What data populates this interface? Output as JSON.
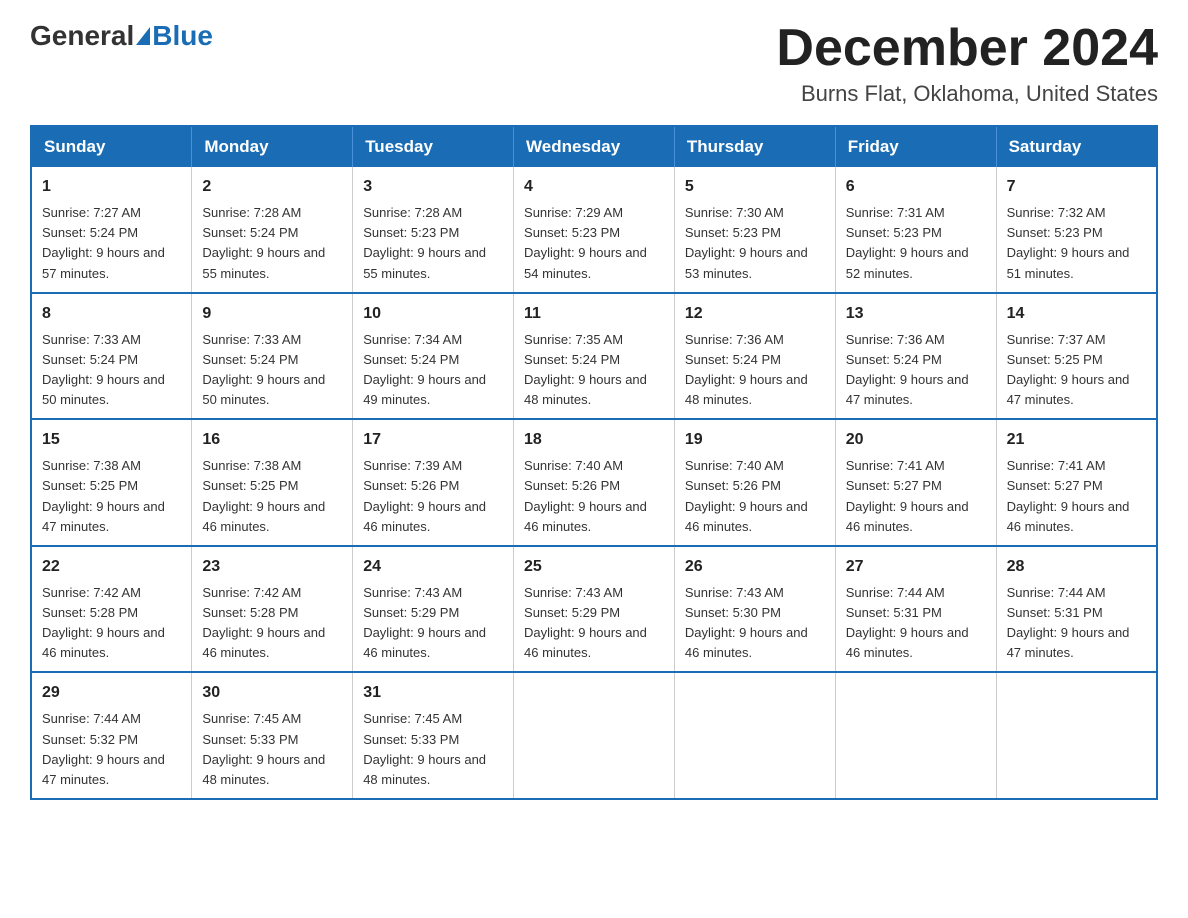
{
  "header": {
    "logo_general": "General",
    "logo_blue": "Blue",
    "month_title": "December 2024",
    "location": "Burns Flat, Oklahoma, United States"
  },
  "days_of_week": [
    "Sunday",
    "Monday",
    "Tuesday",
    "Wednesday",
    "Thursday",
    "Friday",
    "Saturday"
  ],
  "weeks": [
    [
      {
        "day": "1",
        "sunrise": "7:27 AM",
        "sunset": "5:24 PM",
        "daylight": "9 hours and 57 minutes."
      },
      {
        "day": "2",
        "sunrise": "7:28 AM",
        "sunset": "5:24 PM",
        "daylight": "9 hours and 55 minutes."
      },
      {
        "day": "3",
        "sunrise": "7:28 AM",
        "sunset": "5:23 PM",
        "daylight": "9 hours and 55 minutes."
      },
      {
        "day": "4",
        "sunrise": "7:29 AM",
        "sunset": "5:23 PM",
        "daylight": "9 hours and 54 minutes."
      },
      {
        "day": "5",
        "sunrise": "7:30 AM",
        "sunset": "5:23 PM",
        "daylight": "9 hours and 53 minutes."
      },
      {
        "day": "6",
        "sunrise": "7:31 AM",
        "sunset": "5:23 PM",
        "daylight": "9 hours and 52 minutes."
      },
      {
        "day": "7",
        "sunrise": "7:32 AM",
        "sunset": "5:23 PM",
        "daylight": "9 hours and 51 minutes."
      }
    ],
    [
      {
        "day": "8",
        "sunrise": "7:33 AM",
        "sunset": "5:24 PM",
        "daylight": "9 hours and 50 minutes."
      },
      {
        "day": "9",
        "sunrise": "7:33 AM",
        "sunset": "5:24 PM",
        "daylight": "9 hours and 50 minutes."
      },
      {
        "day": "10",
        "sunrise": "7:34 AM",
        "sunset": "5:24 PM",
        "daylight": "9 hours and 49 minutes."
      },
      {
        "day": "11",
        "sunrise": "7:35 AM",
        "sunset": "5:24 PM",
        "daylight": "9 hours and 48 minutes."
      },
      {
        "day": "12",
        "sunrise": "7:36 AM",
        "sunset": "5:24 PM",
        "daylight": "9 hours and 48 minutes."
      },
      {
        "day": "13",
        "sunrise": "7:36 AM",
        "sunset": "5:24 PM",
        "daylight": "9 hours and 47 minutes."
      },
      {
        "day": "14",
        "sunrise": "7:37 AM",
        "sunset": "5:25 PM",
        "daylight": "9 hours and 47 minutes."
      }
    ],
    [
      {
        "day": "15",
        "sunrise": "7:38 AM",
        "sunset": "5:25 PM",
        "daylight": "9 hours and 47 minutes."
      },
      {
        "day": "16",
        "sunrise": "7:38 AM",
        "sunset": "5:25 PM",
        "daylight": "9 hours and 46 minutes."
      },
      {
        "day": "17",
        "sunrise": "7:39 AM",
        "sunset": "5:26 PM",
        "daylight": "9 hours and 46 minutes."
      },
      {
        "day": "18",
        "sunrise": "7:40 AM",
        "sunset": "5:26 PM",
        "daylight": "9 hours and 46 minutes."
      },
      {
        "day": "19",
        "sunrise": "7:40 AM",
        "sunset": "5:26 PM",
        "daylight": "9 hours and 46 minutes."
      },
      {
        "day": "20",
        "sunrise": "7:41 AM",
        "sunset": "5:27 PM",
        "daylight": "9 hours and 46 minutes."
      },
      {
        "day": "21",
        "sunrise": "7:41 AM",
        "sunset": "5:27 PM",
        "daylight": "9 hours and 46 minutes."
      }
    ],
    [
      {
        "day": "22",
        "sunrise": "7:42 AM",
        "sunset": "5:28 PM",
        "daylight": "9 hours and 46 minutes."
      },
      {
        "day": "23",
        "sunrise": "7:42 AM",
        "sunset": "5:28 PM",
        "daylight": "9 hours and 46 minutes."
      },
      {
        "day": "24",
        "sunrise": "7:43 AM",
        "sunset": "5:29 PM",
        "daylight": "9 hours and 46 minutes."
      },
      {
        "day": "25",
        "sunrise": "7:43 AM",
        "sunset": "5:29 PM",
        "daylight": "9 hours and 46 minutes."
      },
      {
        "day": "26",
        "sunrise": "7:43 AM",
        "sunset": "5:30 PM",
        "daylight": "9 hours and 46 minutes."
      },
      {
        "day": "27",
        "sunrise": "7:44 AM",
        "sunset": "5:31 PM",
        "daylight": "9 hours and 46 minutes."
      },
      {
        "day": "28",
        "sunrise": "7:44 AM",
        "sunset": "5:31 PM",
        "daylight": "9 hours and 47 minutes."
      }
    ],
    [
      {
        "day": "29",
        "sunrise": "7:44 AM",
        "sunset": "5:32 PM",
        "daylight": "9 hours and 47 minutes."
      },
      {
        "day": "30",
        "sunrise": "7:45 AM",
        "sunset": "5:33 PM",
        "daylight": "9 hours and 48 minutes."
      },
      {
        "day": "31",
        "sunrise": "7:45 AM",
        "sunset": "5:33 PM",
        "daylight": "9 hours and 48 minutes."
      },
      null,
      null,
      null,
      null
    ]
  ]
}
